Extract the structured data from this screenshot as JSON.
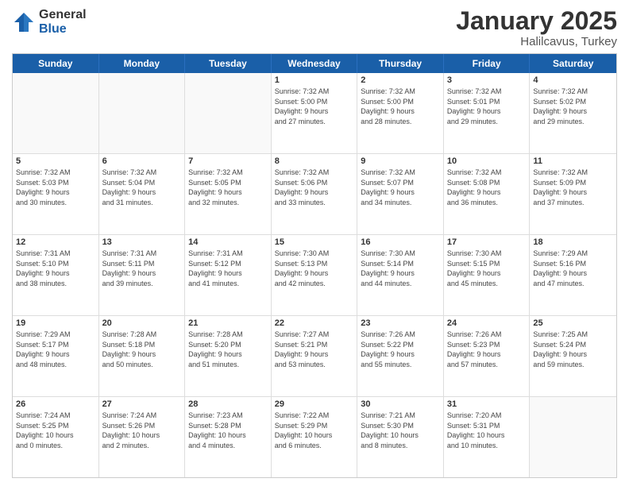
{
  "logo": {
    "general": "General",
    "blue": "Blue"
  },
  "header": {
    "month": "January 2025",
    "location": "Halilcavus, Turkey"
  },
  "weekdays": [
    "Sunday",
    "Monday",
    "Tuesday",
    "Wednesday",
    "Thursday",
    "Friday",
    "Saturday"
  ],
  "rows": [
    [
      {
        "day": "",
        "text": ""
      },
      {
        "day": "",
        "text": ""
      },
      {
        "day": "",
        "text": ""
      },
      {
        "day": "1",
        "text": "Sunrise: 7:32 AM\nSunset: 5:00 PM\nDaylight: 9 hours\nand 27 minutes."
      },
      {
        "day": "2",
        "text": "Sunrise: 7:32 AM\nSunset: 5:00 PM\nDaylight: 9 hours\nand 28 minutes."
      },
      {
        "day": "3",
        "text": "Sunrise: 7:32 AM\nSunset: 5:01 PM\nDaylight: 9 hours\nand 29 minutes."
      },
      {
        "day": "4",
        "text": "Sunrise: 7:32 AM\nSunset: 5:02 PM\nDaylight: 9 hours\nand 29 minutes."
      }
    ],
    [
      {
        "day": "5",
        "text": "Sunrise: 7:32 AM\nSunset: 5:03 PM\nDaylight: 9 hours\nand 30 minutes."
      },
      {
        "day": "6",
        "text": "Sunrise: 7:32 AM\nSunset: 5:04 PM\nDaylight: 9 hours\nand 31 minutes."
      },
      {
        "day": "7",
        "text": "Sunrise: 7:32 AM\nSunset: 5:05 PM\nDaylight: 9 hours\nand 32 minutes."
      },
      {
        "day": "8",
        "text": "Sunrise: 7:32 AM\nSunset: 5:06 PM\nDaylight: 9 hours\nand 33 minutes."
      },
      {
        "day": "9",
        "text": "Sunrise: 7:32 AM\nSunset: 5:07 PM\nDaylight: 9 hours\nand 34 minutes."
      },
      {
        "day": "10",
        "text": "Sunrise: 7:32 AM\nSunset: 5:08 PM\nDaylight: 9 hours\nand 36 minutes."
      },
      {
        "day": "11",
        "text": "Sunrise: 7:32 AM\nSunset: 5:09 PM\nDaylight: 9 hours\nand 37 minutes."
      }
    ],
    [
      {
        "day": "12",
        "text": "Sunrise: 7:31 AM\nSunset: 5:10 PM\nDaylight: 9 hours\nand 38 minutes."
      },
      {
        "day": "13",
        "text": "Sunrise: 7:31 AM\nSunset: 5:11 PM\nDaylight: 9 hours\nand 39 minutes."
      },
      {
        "day": "14",
        "text": "Sunrise: 7:31 AM\nSunset: 5:12 PM\nDaylight: 9 hours\nand 41 minutes."
      },
      {
        "day": "15",
        "text": "Sunrise: 7:30 AM\nSunset: 5:13 PM\nDaylight: 9 hours\nand 42 minutes."
      },
      {
        "day": "16",
        "text": "Sunrise: 7:30 AM\nSunset: 5:14 PM\nDaylight: 9 hours\nand 44 minutes."
      },
      {
        "day": "17",
        "text": "Sunrise: 7:30 AM\nSunset: 5:15 PM\nDaylight: 9 hours\nand 45 minutes."
      },
      {
        "day": "18",
        "text": "Sunrise: 7:29 AM\nSunset: 5:16 PM\nDaylight: 9 hours\nand 47 minutes."
      }
    ],
    [
      {
        "day": "19",
        "text": "Sunrise: 7:29 AM\nSunset: 5:17 PM\nDaylight: 9 hours\nand 48 minutes."
      },
      {
        "day": "20",
        "text": "Sunrise: 7:28 AM\nSunset: 5:18 PM\nDaylight: 9 hours\nand 50 minutes."
      },
      {
        "day": "21",
        "text": "Sunrise: 7:28 AM\nSunset: 5:20 PM\nDaylight: 9 hours\nand 51 minutes."
      },
      {
        "day": "22",
        "text": "Sunrise: 7:27 AM\nSunset: 5:21 PM\nDaylight: 9 hours\nand 53 minutes."
      },
      {
        "day": "23",
        "text": "Sunrise: 7:26 AM\nSunset: 5:22 PM\nDaylight: 9 hours\nand 55 minutes."
      },
      {
        "day": "24",
        "text": "Sunrise: 7:26 AM\nSunset: 5:23 PM\nDaylight: 9 hours\nand 57 minutes."
      },
      {
        "day": "25",
        "text": "Sunrise: 7:25 AM\nSunset: 5:24 PM\nDaylight: 9 hours\nand 59 minutes."
      }
    ],
    [
      {
        "day": "26",
        "text": "Sunrise: 7:24 AM\nSunset: 5:25 PM\nDaylight: 10 hours\nand 0 minutes."
      },
      {
        "day": "27",
        "text": "Sunrise: 7:24 AM\nSunset: 5:26 PM\nDaylight: 10 hours\nand 2 minutes."
      },
      {
        "day": "28",
        "text": "Sunrise: 7:23 AM\nSunset: 5:28 PM\nDaylight: 10 hours\nand 4 minutes."
      },
      {
        "day": "29",
        "text": "Sunrise: 7:22 AM\nSunset: 5:29 PM\nDaylight: 10 hours\nand 6 minutes."
      },
      {
        "day": "30",
        "text": "Sunrise: 7:21 AM\nSunset: 5:30 PM\nDaylight: 10 hours\nand 8 minutes."
      },
      {
        "day": "31",
        "text": "Sunrise: 7:20 AM\nSunset: 5:31 PM\nDaylight: 10 hours\nand 10 minutes."
      },
      {
        "day": "",
        "text": ""
      }
    ]
  ]
}
